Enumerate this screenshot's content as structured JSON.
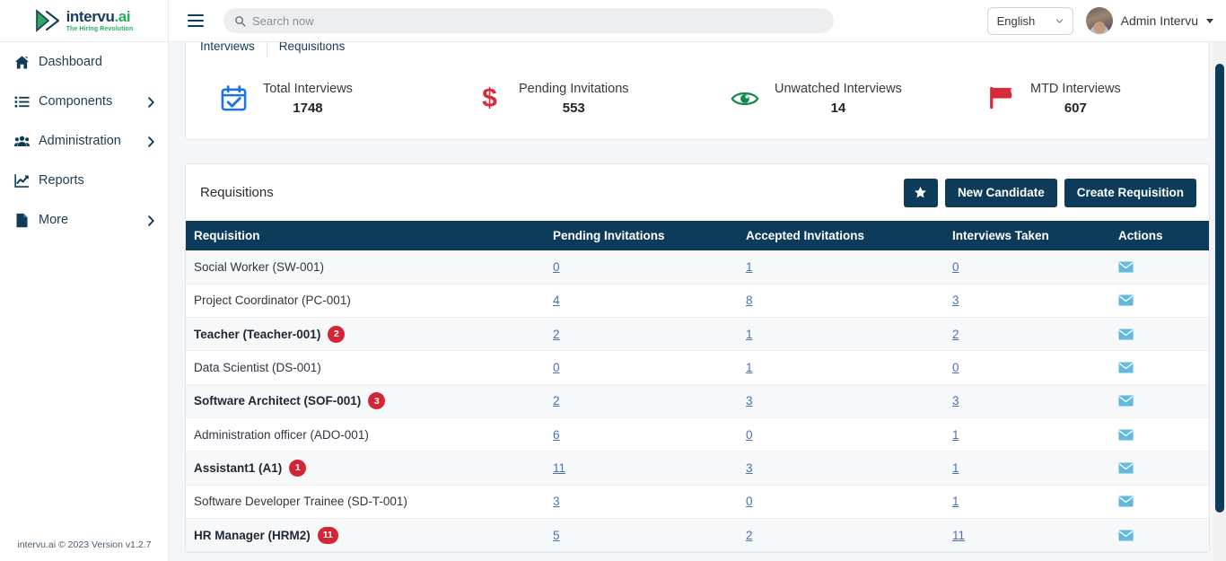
{
  "brand": {
    "name_primary": "intervu",
    "name_accent": ".ai",
    "tagline": "The Hiring Revolution"
  },
  "topbar": {
    "menu_icon": "hamburger-icon",
    "search": {
      "icon": "search-icon",
      "placeholder": "Search now",
      "value": ""
    },
    "language": {
      "selected": "English",
      "icon": "chevron-down-icon"
    },
    "user": {
      "name": "Admin Intervu",
      "icon": "caret-down-icon"
    }
  },
  "sidebar": {
    "items": [
      {
        "label": "Dashboard",
        "icon": "home-icon",
        "has_chevron": false
      },
      {
        "label": "Components",
        "icon": "list-icon",
        "has_chevron": true
      },
      {
        "label": "Administration",
        "icon": "users-icon",
        "has_chevron": true
      },
      {
        "label": "Reports",
        "icon": "chart-icon",
        "has_chevron": false
      },
      {
        "label": "More",
        "icon": "file-icon",
        "has_chevron": true
      }
    ],
    "footer": "intervu.ai © 2023 Version v1.2.7"
  },
  "tabs": [
    {
      "label": "Interviews",
      "active": true
    },
    {
      "label": "Requisitions",
      "active": false
    }
  ],
  "stats": [
    {
      "label": "Total Interviews",
      "value": "1748",
      "icon": "calendar-check-icon",
      "color": "#1a73e8"
    },
    {
      "label": "Pending Invitations",
      "value": "553",
      "icon": "dollar-icon",
      "color": "#d62b3a"
    },
    {
      "label": "Unwatched Interviews",
      "value": "14",
      "icon": "eye-icon",
      "color": "#0f8a4d"
    },
    {
      "label": "MTD Interviews",
      "value": "607",
      "icon": "flag-icon",
      "color": "#d62b3a"
    }
  ],
  "requisitions_panel": {
    "title": "Requisitions",
    "star_button_icon": "star-icon",
    "new_candidate_label": "New Candidate",
    "create_requisition_label": "Create Requisition",
    "columns": [
      "Requisition",
      "Pending Invitations",
      "Accepted Invitations",
      "Interviews Taken",
      "Actions"
    ],
    "rows": [
      {
        "name": "Social Worker (SW-001)",
        "badge": null,
        "pending": "0",
        "accepted": "1",
        "taken": "0",
        "action_icon": "envelope-icon"
      },
      {
        "name": "Project Coordinator (PC-001)",
        "badge": null,
        "pending": "4",
        "accepted": "8",
        "taken": "3",
        "action_icon": "envelope-icon"
      },
      {
        "name": "Teacher (Teacher-001)",
        "badge": "2",
        "pending": "2",
        "accepted": "1",
        "taken": "2",
        "action_icon": "envelope-icon"
      },
      {
        "name": "Data Scientist (DS-001)",
        "badge": null,
        "pending": "0",
        "accepted": "1",
        "taken": "0",
        "action_icon": "envelope-icon"
      },
      {
        "name": "Software Architect (SOF-001)",
        "badge": "3",
        "pending": "2",
        "accepted": "3",
        "taken": "3",
        "action_icon": "envelope-icon"
      },
      {
        "name": "Administration officer (ADO-001)",
        "badge": null,
        "pending": "6",
        "accepted": "0",
        "taken": "1",
        "action_icon": "envelope-icon"
      },
      {
        "name": "Assistant1 (A1)",
        "badge": "1",
        "pending": "11",
        "accepted": "3",
        "taken": "1",
        "action_icon": "envelope-icon"
      },
      {
        "name": "Software Developer Trainee (SD-T-001)",
        "badge": null,
        "pending": "3",
        "accepted": "0",
        "taken": "1",
        "action_icon": "envelope-icon"
      },
      {
        "name": "HR Manager (HRM2)",
        "badge": "11",
        "pending": "5",
        "accepted": "2",
        "taken": "11",
        "action_icon": "envelope-icon"
      }
    ]
  },
  "colors": {
    "brand_navy": "#0d3c5a",
    "brand_green": "#27ae60",
    "badge_red": "#d32535",
    "link_blue": "#4b6fb5",
    "envelope_blue": "#63bae0"
  }
}
